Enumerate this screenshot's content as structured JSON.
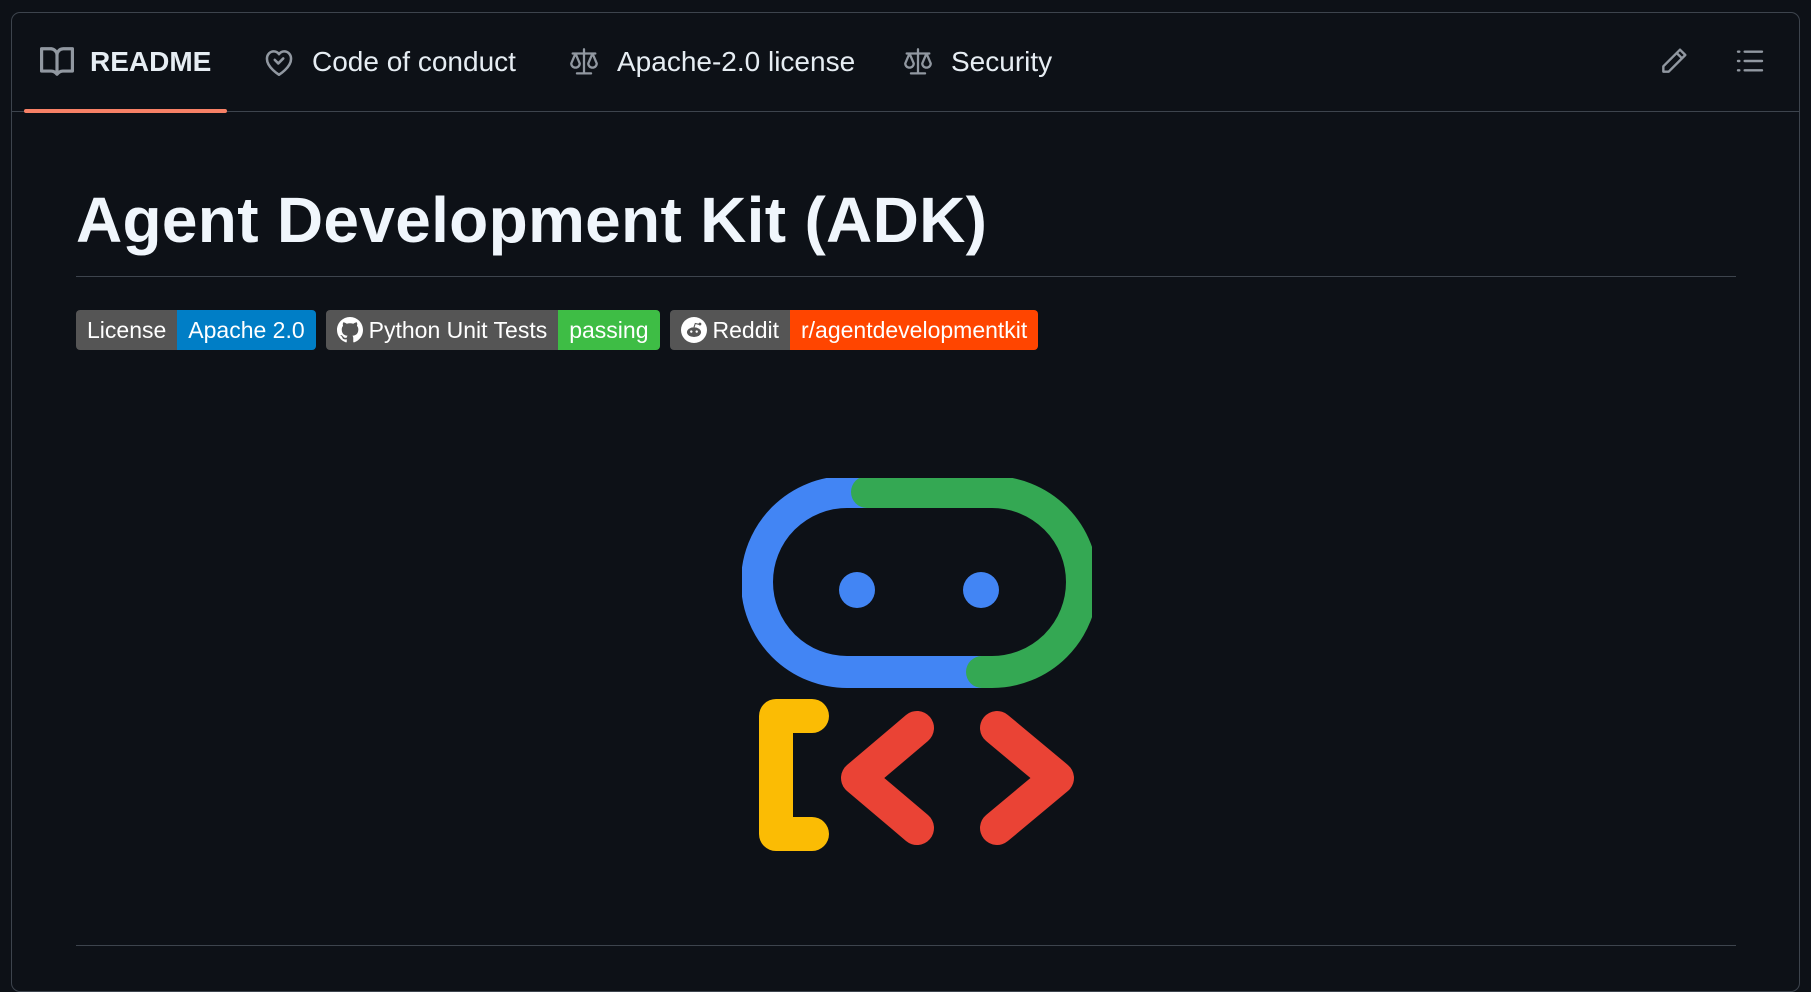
{
  "tabs": [
    {
      "label": "README",
      "icon": "book-icon",
      "active": true
    },
    {
      "label": "Code of conduct",
      "icon": "heart-handshake-icon"
    },
    {
      "label": "Apache-2.0 license",
      "icon": "law-scale-icon"
    },
    {
      "label": "Security",
      "icon": "law-scale-icon"
    }
  ],
  "toolbar": {
    "edit_icon": "pencil-icon",
    "outline_icon": "list-icon"
  },
  "readme": {
    "title": "Agent Development Kit (ADK)",
    "badges": [
      {
        "label": "License",
        "value": "Apache 2.0",
        "color": "#007ec6"
      },
      {
        "label": "Python Unit Tests",
        "value": "passing",
        "color": "#4c1",
        "icon": "github-icon"
      },
      {
        "label": "Reddit",
        "value": "r/agentdevelopmentkit",
        "color": "#ff4500",
        "icon": "reddit-icon"
      }
    ]
  },
  "colors": {
    "background": "#0d1117",
    "border": "#3d444d",
    "active_tab": "#f78166",
    "logo_blue": "#4285f4",
    "logo_green": "#34a853",
    "logo_yellow": "#fbbc04",
    "logo_red": "#ea4335"
  }
}
